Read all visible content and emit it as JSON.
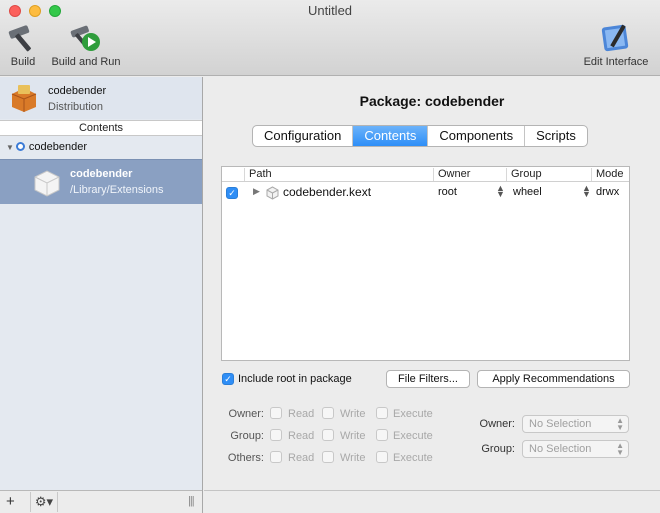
{
  "window": {
    "title": "Untitled"
  },
  "toolbar": {
    "build_label": "Build",
    "build_run_label": "Build and Run",
    "edit_interface_label": "Edit Interface"
  },
  "sidebar": {
    "distribution": {
      "name": "codebender",
      "kind": "Distribution"
    },
    "contents_header": "Contents",
    "tree_root": "codebender",
    "selected_item": {
      "name": "codebender",
      "path": "/Library/Extensions"
    },
    "footer": {
      "add": "+",
      "gear": "⚙▾",
      "grip": "|||"
    }
  },
  "main": {
    "title": "Package: codebender",
    "tabs": [
      {
        "label": "Configuration"
      },
      {
        "label": "Contents",
        "active": true
      },
      {
        "label": "Components"
      },
      {
        "label": "Scripts"
      }
    ],
    "table": {
      "columns": [
        "Path",
        "Owner",
        "Group",
        "Mode"
      ],
      "rows": [
        {
          "checked": true,
          "path": "codebender.kext",
          "owner": "root",
          "group": "wheel",
          "mode": "drwx"
        }
      ]
    },
    "include_root_label": "Include root in package",
    "file_filters_label": "File Filters...",
    "apply_recommendations_label": "Apply Recommendations",
    "permissions": {
      "rows": [
        "Owner:",
        "Group:",
        "Others:"
      ],
      "read": "Read",
      "write": "Write",
      "execute": "Execute"
    },
    "owner_select": {
      "label": "Owner:",
      "value": "No Selection"
    },
    "group_select": {
      "label": "Group:",
      "value": "No Selection"
    }
  },
  "colors": {
    "accent": "#2d8ef7",
    "sidebar_selection": "#8aa0c2"
  }
}
